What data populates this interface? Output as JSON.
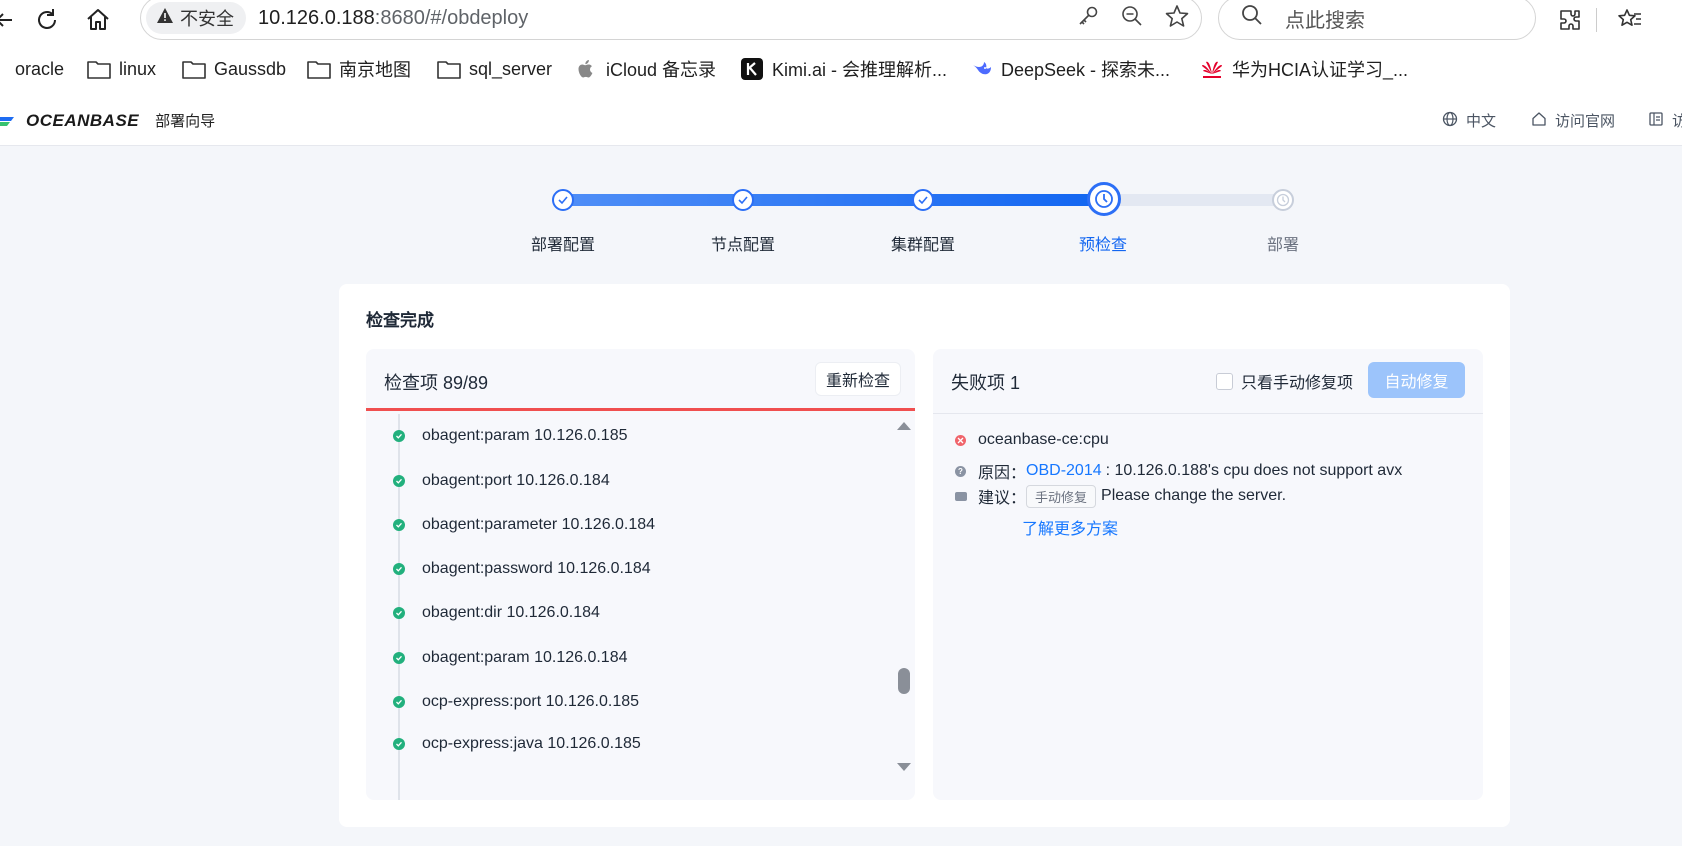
{
  "browser": {
    "security_label": "不安全",
    "url_host": "10.126.0.188",
    "url_rest": ":8680/#/obdeploy",
    "search_placeholder": "点此搜索"
  },
  "bookmarks": [
    {
      "label": "oracle"
    },
    {
      "label": "linux"
    },
    {
      "label": "Gaussdb"
    },
    {
      "label": "南京地图"
    },
    {
      "label": "sql_server"
    },
    {
      "label": "iCloud 备忘录"
    },
    {
      "label": "Kimi.ai - 会推理解析..."
    },
    {
      "label": "DeepSeek - 探索未..."
    },
    {
      "label": "华为HCIA认证学习_..."
    }
  ],
  "app": {
    "brand": "OCEANBASE",
    "subtitle": "部署向导",
    "lang": "中文",
    "official_site": "访问官网",
    "truncated_item": "访"
  },
  "steps": [
    {
      "label": "部署配置",
      "status": "done"
    },
    {
      "label": "节点配置",
      "status": "done"
    },
    {
      "label": "集群配置",
      "status": "done"
    },
    {
      "label": "预检查",
      "status": "active"
    },
    {
      "label": "部署",
      "status": "todo"
    }
  ],
  "card": {
    "title": "检查完成",
    "left_panel": {
      "title": "检查项 89/89",
      "recheck_button": "重新检查",
      "items": [
        "obagent:param 10.126.0.185",
        "obagent:port 10.126.0.184",
        "obagent:parameter 10.126.0.184",
        "obagent:password 10.126.0.184",
        "obagent:dir 10.126.0.184",
        "obagent:param 10.126.0.184",
        "ocp-express:port 10.126.0.185",
        "ocp-express:java 10.126.0.185"
      ]
    },
    "right_panel": {
      "title": "失败项 1",
      "manual_only_label": "只看手动修复项",
      "auto_fix_button": "自动修复",
      "failure": {
        "name": "oceanbase-ce:cpu",
        "reason_label": "原因：",
        "reason_code": "OBD-2014",
        "reason_text": ": 10.126.0.188's cpu does not support avx",
        "suggest_label": "建议：",
        "suggest_tag": "手动修复",
        "suggest_text": "Please change the server.",
        "more_link": "了解更多方案"
      }
    }
  },
  "colors": {
    "primary": "#1266f1",
    "success": "#22b07d",
    "error": "#f0646b",
    "error_underline": "#f04f4f"
  }
}
